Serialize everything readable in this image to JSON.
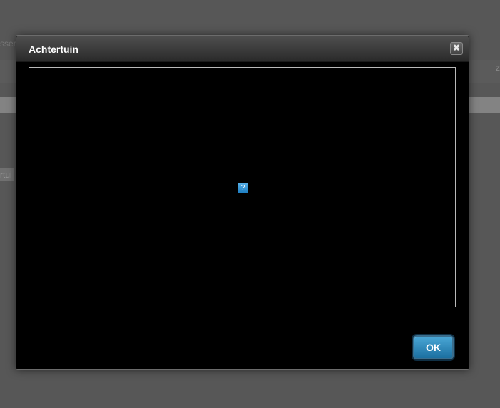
{
  "background": {
    "partial_text_left": "sser",
    "partial_text_right": "z",
    "partial_chip_text": "rtui"
  },
  "dialog": {
    "title": "Achtertuin",
    "close_icon": "close-icon",
    "close_glyph": "✖",
    "image_placeholder_glyph": "?",
    "ok_label": "OK"
  },
  "colors": {
    "accent": "#1f7fc2",
    "dialog_bg": "#000000",
    "overlay": "#575757"
  }
}
